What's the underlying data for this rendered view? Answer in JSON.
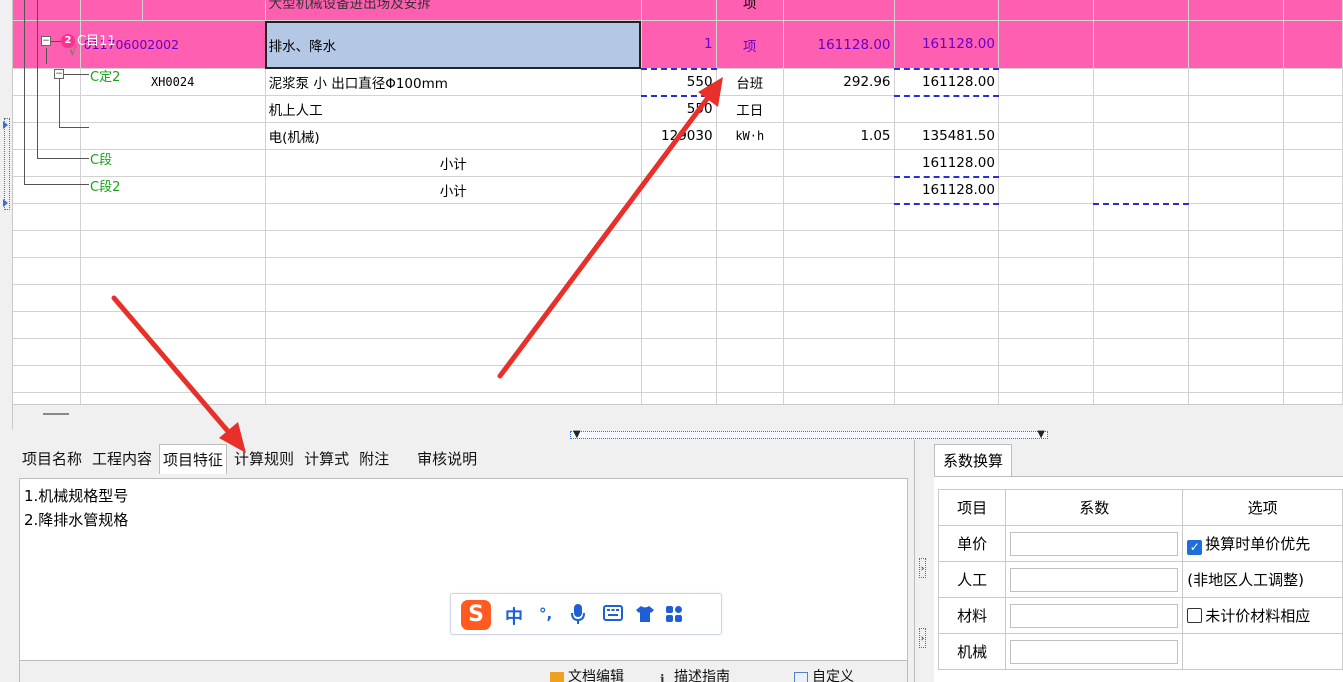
{
  "grid": {
    "top_partial": {
      "type": "项",
      "name": "大型机械设备进出场及安拆"
    },
    "row1": {
      "tree_code": "C目11",
      "code": "011706002002",
      "name": "排水、降水",
      "qty": "1",
      "unit": "项",
      "unit_price": "161128.00",
      "total": "161128.00"
    },
    "row2": {
      "tree_code": "C定2",
      "code": "XH0024",
      "name": "泥浆泵 小 出口直径Φ100mm",
      "qty": "550",
      "unit": "台班",
      "unit_price": "292.96",
      "total": "161128.00"
    },
    "row3": {
      "name": "机上人工",
      "qty": "550",
      "unit": "工日"
    },
    "row4": {
      "name": "电(机械)",
      "qty": "129030",
      "unit": "kW·h",
      "unit_price": "1.05",
      "total": "135481.50"
    },
    "row5": {
      "tree_code": "C段",
      "name": "小计",
      "total": "161128.00"
    },
    "row6": {
      "tree_code": "C段2",
      "name": "小计",
      "total": "161128.00"
    }
  },
  "tabs": {
    "t1": "项目名称",
    "t2": "工程内容",
    "t3": "项目特征",
    "t4": "计算规则",
    "t5": "计算式",
    "t6": "附注",
    "t7": "审核说明"
  },
  "features": {
    "line1": "1.机械规格型号",
    "line2": "2.降排水管规格"
  },
  "toolbar": {
    "item1": "文档编辑",
    "item2": "描述指南",
    "item3": "自定义"
  },
  "ime": {
    "logo": "S",
    "lang": "中",
    "punct": "°,"
  },
  "coef": {
    "tab": "系数换算",
    "header_item": "项目",
    "header_coef": "系数",
    "header_option": "选项",
    "rows": {
      "r1": {
        "item": "单价",
        "option": "换算时单价优先"
      },
      "r2": {
        "item": "人工",
        "option": "(非地区人工调整)"
      },
      "r3": {
        "item": "材料",
        "option": "未计价材料相应"
      },
      "r4": {
        "item": "机械",
        "option": ""
      }
    }
  },
  "colors": {
    "pink_row": "#ff5fb0",
    "selected_cell": "#b4c8e6",
    "tree_green": "#18a018",
    "code_purple": "#6a00c8",
    "annotation_red": "#e8302a"
  }
}
